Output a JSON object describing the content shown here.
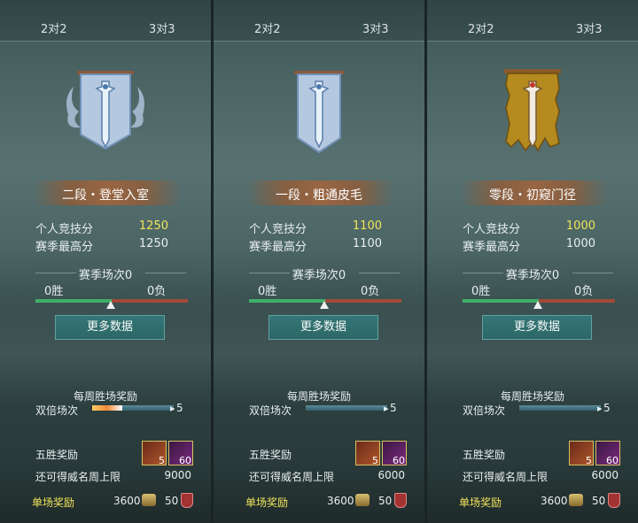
{
  "panels": [
    {
      "tab_left": "2对2",
      "tab_right": "3对3",
      "rank": "二段・登堂入室",
      "banner": "silver-winged",
      "personal_label": "个人竞技分",
      "personal_value": "1250",
      "season_high_label": "赛季最高分",
      "season_high_value": "1250",
      "season_games": "赛季场次0",
      "wins": "0胜",
      "losses": "0负",
      "more_button": "更多数据",
      "weekly_reward": "每周胜场奖励",
      "double_label": "双倍场次",
      "double_count": "5",
      "five_win": "五胜奖励",
      "chest_count": "5",
      "gem_count": "60",
      "cap_label": "还可得威名周上限",
      "cap_value": "9000",
      "single_label": "单场奖励",
      "single_coin": "3600",
      "single_shield": "50"
    },
    {
      "tab_left": "2对2",
      "tab_right": "3对3",
      "rank": "一段・粗通皮毛",
      "banner": "silver",
      "personal_label": "个人竞技分",
      "personal_value": "1100",
      "season_high_label": "赛季最高分",
      "season_high_value": "1100",
      "season_games": "赛季场次0",
      "wins": "0胜",
      "losses": "0负",
      "more_button": "更多数据",
      "weekly_reward": "每周胜场奖励",
      "double_label": "双倍场次",
      "double_count": "5",
      "five_win": "五胜奖励",
      "chest_count": "5",
      "gem_count": "60",
      "cap_label": "还可得威名周上限",
      "cap_value": "6000",
      "single_label": "单场奖励",
      "single_coin": "3600",
      "single_shield": "50"
    },
    {
      "tab_left": "2对2",
      "tab_right": "3对3",
      "rank": "零段・初窥门径",
      "banner": "gold",
      "personal_label": "个人竞技分",
      "personal_value": "1000",
      "season_high_label": "赛季最高分",
      "season_high_value": "1000",
      "season_games": "赛季场次0",
      "wins": "0胜",
      "losses": "0负",
      "more_button": "更多数据",
      "weekly_reward": "每周胜场奖励",
      "double_label": "双倍场次",
      "double_count": "5",
      "five_win": "五胜奖励",
      "chest_count": "5",
      "gem_count": "60",
      "cap_label": "还可得威名周上限",
      "cap_value": "6000",
      "single_label": "单场奖励",
      "single_coin": "3600",
      "single_shield": "50"
    }
  ],
  "colors": {
    "gold_text": "#f2e55a",
    "win_bar": "#3fae6a",
    "loss_bar": "#a34a36",
    "button": "#2f7474"
  }
}
